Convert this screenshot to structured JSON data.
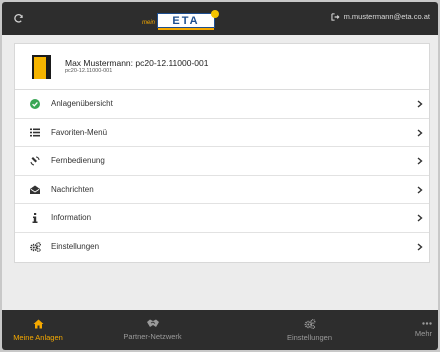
{
  "topbar": {
    "logo_prefix": "mein",
    "logo_text": "ETA",
    "user_email": "m.mustermann@eta.co.at"
  },
  "device": {
    "title": "Max Mustermann: pc20-12.11000-001",
    "subtitle": "pc20-12.11000-001"
  },
  "menu": {
    "items": [
      {
        "label": "Anlagenübersicht",
        "icon": "check-circle-icon"
      },
      {
        "label": "Favoriten-Menü",
        "icon": "list-icon"
      },
      {
        "label": "Fernbedienung",
        "icon": "remote-signal-icon"
      },
      {
        "label": "Nachrichten",
        "icon": "envelope-open-icon"
      },
      {
        "label": "Information",
        "icon": "info-icon"
      },
      {
        "label": "Einstellungen",
        "icon": "gears-icon"
      }
    ]
  },
  "bottom_nav": {
    "items": [
      {
        "label": "Meine Anlagen",
        "icon": "home-icon",
        "active": true
      },
      {
        "label": "Partner-Netzwerk",
        "icon": "handshake-icon",
        "active": false
      },
      {
        "label": "Einstellungen",
        "icon": "gears-icon",
        "active": false
      },
      {
        "label": "Mehr",
        "icon": "ellipsis-icon",
        "active": false
      }
    ]
  },
  "colors": {
    "bar_bg": "#2d2d2d",
    "accent": "#f5a900",
    "check_green": "#3aa655",
    "logo_blue": "#1d4e8f"
  }
}
